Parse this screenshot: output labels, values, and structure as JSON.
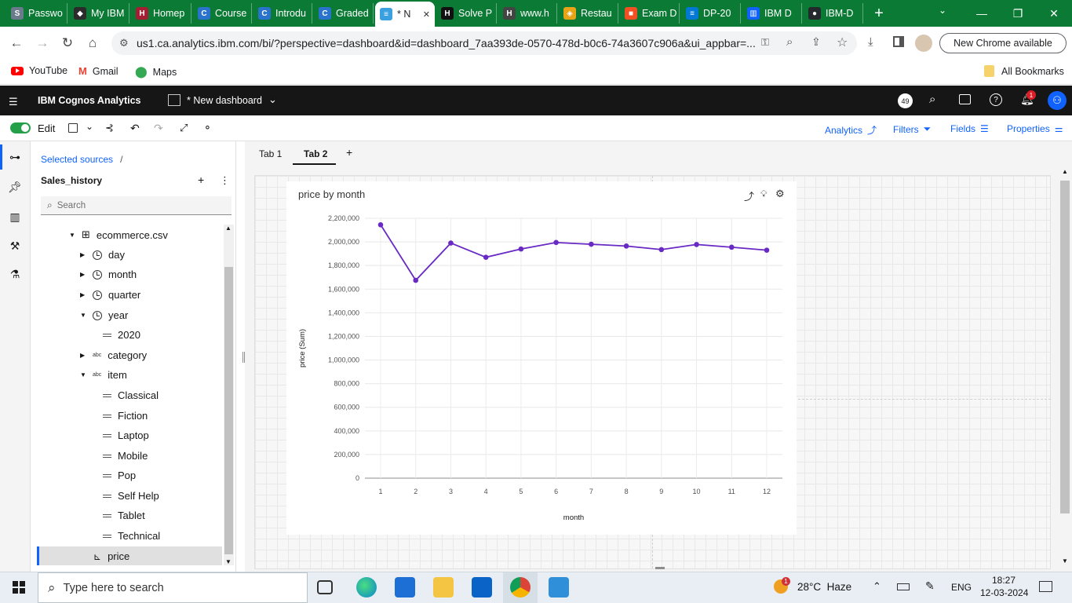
{
  "browser": {
    "tabs": [
      {
        "label": "Passwo",
        "fav_color": "#6b7b8c",
        "fav_text": "S"
      },
      {
        "label": "My IBM",
        "fav_color": "#2b2b2b",
        "fav_text": "◆"
      },
      {
        "label": "Homep",
        "fav_color": "#a41e34",
        "fav_text": "H"
      },
      {
        "label": "Course",
        "fav_color": "#2a73cc",
        "fav_text": "C"
      },
      {
        "label": "Introdu",
        "fav_color": "#2a73cc",
        "fav_text": "C"
      },
      {
        "label": "Graded",
        "fav_color": "#2a73cc",
        "fav_text": "C"
      },
      {
        "label": "* N",
        "fav_color": "#3aa0e0",
        "fav_text": "≡"
      },
      {
        "label": "Solve P",
        "fav_color": "#111111",
        "fav_text": "H"
      },
      {
        "label": "www.h",
        "fav_color": "#444444",
        "fav_text": "H"
      },
      {
        "label": "Restau",
        "fav_color": "#e8a317",
        "fav_text": "◈"
      },
      {
        "label": "Exam D",
        "fav_color": "#f25022",
        "fav_text": "■"
      },
      {
        "label": "DP-20",
        "fav_color": "#0078d4",
        "fav_text": "≡"
      },
      {
        "label": "IBM D",
        "fav_color": "#0f62fe",
        "fav_text": "▥"
      },
      {
        "label": "IBM-D",
        "fav_color": "#24292e",
        "fav_text": "●"
      }
    ],
    "new_tab": "+",
    "url": "us1.ca.analytics.ibm.com/bi/?perspective=dashboard&id=dashboard_7aa393de-0570-478d-b0c6-74a3607c906a&ui_appbar=...",
    "new_chrome": "New Chrome available",
    "bookmarks": [
      {
        "label": "YouTube"
      },
      {
        "label": "Gmail"
      },
      {
        "label": "Maps"
      }
    ],
    "all_bookmarks": "All Bookmarks"
  },
  "app": {
    "name": "IBM Cognos Analytics",
    "dashboard_title": "* New dashboard",
    "notification_count": "1",
    "avatar_badge": "49",
    "edit_label": "Edit",
    "toolbar_right": [
      "Analytics",
      "Filters",
      "Fields",
      "Properties"
    ]
  },
  "sources": {
    "breadcrumb": "Selected sources",
    "breadcrumb_sep": "/",
    "source_name": "Sales_history",
    "search_placeholder": "Search",
    "tree": [
      {
        "label": "ecommerce.csv",
        "kind": "table",
        "indent": 0,
        "caret": "down"
      },
      {
        "label": "day",
        "kind": "time",
        "indent": 1,
        "caret": "right"
      },
      {
        "label": "month",
        "kind": "time",
        "indent": 1,
        "caret": "right"
      },
      {
        "label": "quarter",
        "kind": "time",
        "indent": 1,
        "caret": "right"
      },
      {
        "label": "year",
        "kind": "time",
        "indent": 1,
        "caret": "down"
      },
      {
        "label": "2020",
        "kind": "member",
        "indent": 2,
        "caret": ""
      },
      {
        "label": "category",
        "kind": "abc",
        "indent": 1,
        "caret": "right"
      },
      {
        "label": "item",
        "kind": "abc",
        "indent": 1,
        "caret": "down"
      },
      {
        "label": "Classical",
        "kind": "member",
        "indent": 2,
        "caret": ""
      },
      {
        "label": "Fiction",
        "kind": "member",
        "indent": 2,
        "caret": ""
      },
      {
        "label": "Laptop",
        "kind": "member",
        "indent": 2,
        "caret": ""
      },
      {
        "label": "Mobile",
        "kind": "member",
        "indent": 2,
        "caret": ""
      },
      {
        "label": "Pop",
        "kind": "member",
        "indent": 2,
        "caret": ""
      },
      {
        "label": "Self Help",
        "kind": "member",
        "indent": 2,
        "caret": ""
      },
      {
        "label": "Tablet",
        "kind": "member",
        "indent": 2,
        "caret": ""
      },
      {
        "label": "Technical",
        "kind": "member",
        "indent": 2,
        "caret": ""
      },
      {
        "label": "price",
        "kind": "measure",
        "indent": 1,
        "caret": "",
        "selected": true
      }
    ]
  },
  "dashboard": {
    "tabs": [
      "Tab 1",
      "Tab 2"
    ],
    "active_tab": 1,
    "add_tab": "+"
  },
  "chart_data": {
    "type": "line",
    "title": "price by month",
    "xlabel": "month",
    "ylabel": "price (Sum)",
    "x": [
      1,
      2,
      3,
      4,
      5,
      6,
      7,
      8,
      9,
      10,
      11,
      12
    ],
    "series": [
      {
        "values": [
          2145000,
          1675000,
          1990000,
          1870000,
          1940000,
          1995000,
          1980000,
          1965000,
          1935000,
          1978000,
          1955000,
          1930000
        ],
        "color": "#6929c4"
      }
    ],
    "ylim": [
      0,
      2200000
    ],
    "yticks": [
      "0",
      "200,000",
      "400,000",
      "600,000",
      "800,000",
      "1,000,000",
      "1,200,000",
      "1,400,000",
      "1,600,000",
      "1,800,000",
      "2,000,000",
      "2,200,000"
    ],
    "grid": true
  },
  "taskbar": {
    "search_placeholder": "Type here to search",
    "weather": "28°C  Haze",
    "lang": "ENG",
    "time": "18:27",
    "date": "12-03-2024",
    "weather_badge": "1"
  }
}
